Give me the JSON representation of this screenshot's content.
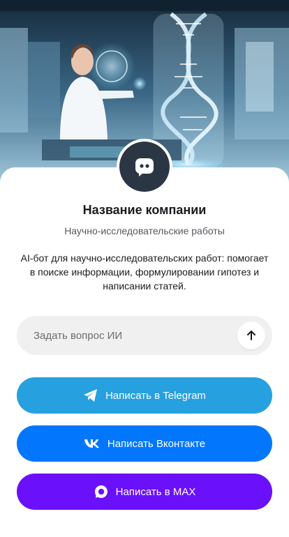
{
  "company": {
    "name": "Название компании",
    "category": "Научно-исследовательские работы",
    "description": "AI-бот для научно-исследовательских работ: помогает в поиске информации, формулировании гипотез и написании статей."
  },
  "ask": {
    "placeholder": "Задать вопрос ИИ",
    "send_icon": "arrow-up-icon"
  },
  "buttons": [
    {
      "label": "Написать в Telegram",
      "icon": "telegram-icon",
      "color": "#27a0df"
    },
    {
      "label": "Написать Вконтакте",
      "icon": "vk-icon",
      "color": "#0277fd"
    },
    {
      "label": "Написать в MAX",
      "icon": "max-icon",
      "color": "#6b10fb"
    }
  ],
  "avatar": {
    "icon": "chat-bot-icon",
    "color": "#2b3645"
  }
}
